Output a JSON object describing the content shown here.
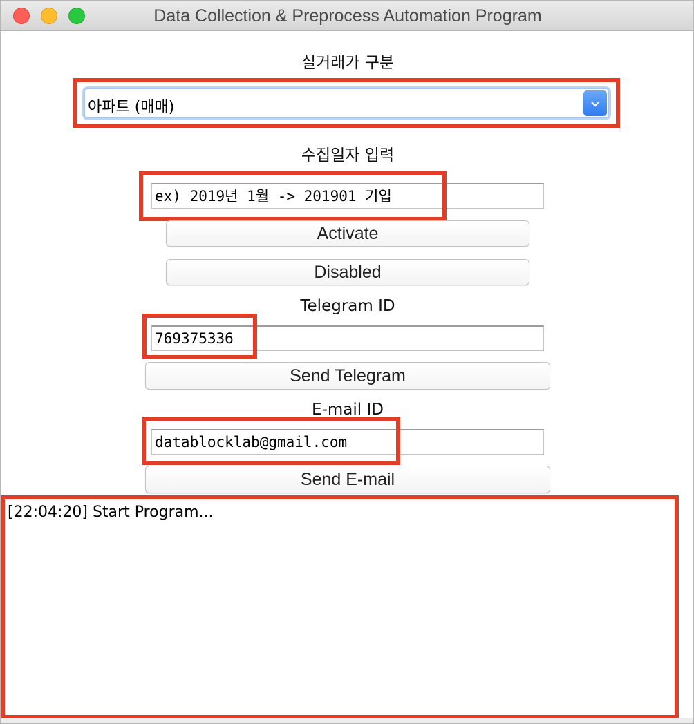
{
  "window": {
    "title": "Data Collection & Preprocess Automation Program"
  },
  "trade_type": {
    "label": "실거래가 구분",
    "selected": "아파트 (매매)"
  },
  "date_input": {
    "label": "수집일자 입력",
    "value": "ex) 2019년 1월 -> 201901 기입"
  },
  "buttons": {
    "activate": "Activate",
    "disabled": "Disabled",
    "send_telegram": "Send Telegram",
    "send_email": "Send E-mail"
  },
  "telegram": {
    "label": "Telegram ID",
    "value": "769375336"
  },
  "email": {
    "label": "E-mail ID",
    "value": "datablocklab@gmail.com"
  },
  "log": {
    "lines": [
      "[22:04:20] Start Program..."
    ]
  },
  "colors": {
    "highlight_box": "#e23d26",
    "combo_arrow": "#2f7cf0"
  },
  "icons": {
    "dropdown": "chevron-down-icon"
  }
}
